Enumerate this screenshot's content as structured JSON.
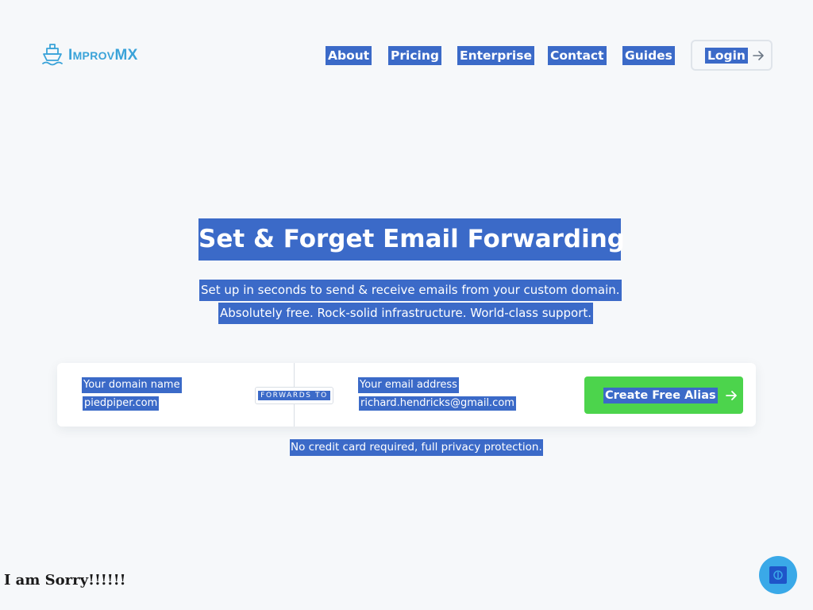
{
  "brand": {
    "name": "ImprovMX",
    "name_first": "I",
    "name_sc": "mprov",
    "name_last": "MX",
    "color": "#3aa3d9"
  },
  "nav": {
    "items": [
      {
        "label": "About"
      },
      {
        "label": "Pricing"
      },
      {
        "label": "Enterprise"
      },
      {
        "label": "Contact"
      },
      {
        "label": "Guides"
      }
    ],
    "login_label": "Login"
  },
  "hero": {
    "title": "Set & Forget Email Forwarding",
    "subtitle_line1": "Set up in seconds to send & receive emails from your custom domain.",
    "subtitle_line2": "Absolutely free. Rock-solid infrastructure. World-class support."
  },
  "form": {
    "domain_label": "Your domain name",
    "domain_value": "piedpiper.com",
    "forwards_to": "FORWARDS TO",
    "email_label": "Your email address",
    "email_value": "richard.hendricks@gmail.com",
    "submit_label": "Create Free Alias",
    "submit_color": "#4cd44c"
  },
  "note": "No credit card required, full privacy protection.",
  "overlay_text": "I am Sorry!!!!!!",
  "colors": {
    "selection": "#3b6ac8",
    "background": "#f6f8fa",
    "chat": "#3aa9e8"
  }
}
